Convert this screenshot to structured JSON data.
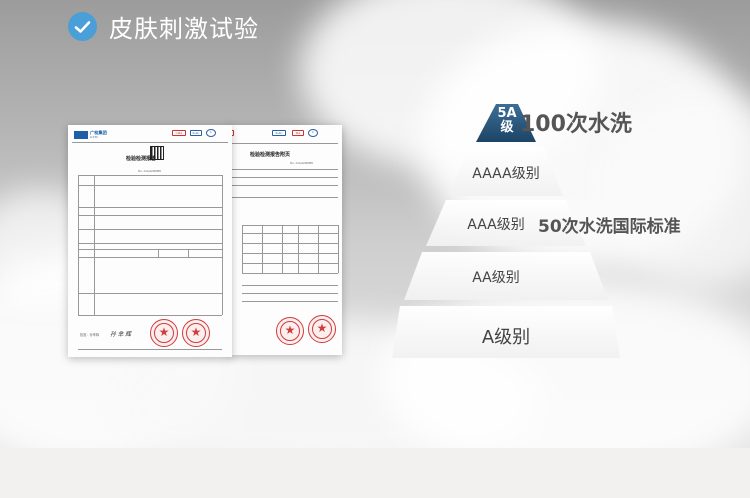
{
  "heading": {
    "title": "皮肤刺激试验"
  },
  "documents": {
    "front": {
      "org_name": "广检集团",
      "org_sub": "GTTC",
      "report_title": "检验检测报告",
      "report_no": "No. 22AA000088",
      "signature": "孙 芈 辉",
      "approver": "批准：孙芈辉"
    },
    "back": {
      "report_title": "检验检测报告附页",
      "report_no": "No. 22AA000088"
    }
  },
  "pyramid": {
    "top_badge": "5A级",
    "top_badge_line1": "5A",
    "top_badge_line2": "级",
    "levels": [
      {
        "label": "AAAA级别"
      },
      {
        "label": "AAA级别"
      },
      {
        "label": "AA级别"
      },
      {
        "label": "A级别"
      }
    ],
    "side_label_top": "100次水洗",
    "side_label_mid": "50次水洗国际标准"
  },
  "colors": {
    "accent_blue": "#4a9fd8",
    "badge_dark_blue": "#1f4f7a",
    "seal_red": "#d23b3b"
  }
}
